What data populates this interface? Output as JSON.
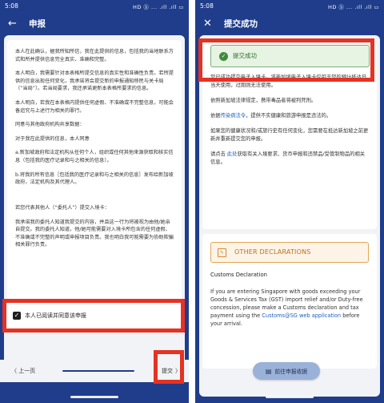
{
  "left": {
    "status": {
      "time": "5:08",
      "icons": "HD ⓑ ... .ıll .ıll ▭"
    },
    "appbar": {
      "back_icon": "←",
      "title": "申报"
    },
    "declaration": [
      "本人在此确认，据我所知所信，我在此提供的信息，包括我的当地联系方式和所并提供信息完全真实、准确和完整。",
      "本人明白，我需要针对本表格所提交信息的真实性和准确性负责。若所提供的信息出现任何变化，我承诺将会提交新的申报通知移民与关卡局（“当局”）。若当局要求，我还承诺更新本表格所要求的信息。",
      "本人明白，若我在本表格内提供任何虚假、不准确或不完整信息，可能会备追究与上述行为相关的罪行。",
      "同意与其他政府机构共享数据：",
      "对于我在此提供的信息，本人同意",
      "a.新加坡政府和法定机构从任何个人，组织或任何其他来源获取和核实信息（包括我的医疗记录和与之相关的信息）。",
      "b.将我的所有信息［包括我的医疗记录和与之相关的信息］发布给新加坡政府，法定机构及其代理人。",
      "若您代表其他人（“委托人”）提交入境卡：",
      "我承诺我的委托人知道我提交的内容，并且这一行为将被视为由他/她亲自提交。我的委托人知道，他/她可能需要对入境卡所包含的任何虚假、不准确或不完整的声明或申报项目负责。我也明白我可能需要为协助欺骗相关罪行负责。"
    ],
    "agree": {
      "check_icon": "✓",
      "label": "本人已阅读并同意该申报"
    },
    "nav": {
      "prev_label": "〈 上一页",
      "submit_label": "提交",
      "submit_icon": "〉"
    }
  },
  "right": {
    "status": {
      "time": "5:08",
      "icons": "HD ⓑ ... .ıll .ıll ▭"
    },
    "appbar": {
      "close_icon": "✕",
      "title": "提交成功"
    },
    "success_banner": {
      "icon": "✓",
      "text": "提交成功"
    },
    "paragraphs": {
      "p1": "您已成功提交电子入境卡。该新加坡电子入境卡仅可于您的预计抵达日当天使用，过期则无法使用。",
      "p2": "依照新加坡法律规定，携带毒品者将被判死刑。",
      "p3_before": "依据",
      "p3_link": "传染病法令",
      "p3_after": "，提供不实健康和旅游申报是违法的。",
      "p4": "如果您的健康状况和/或旅行史有任何变化，您需要在抵达新加坡之前更新并重新提交您的申报。",
      "p5_before": "请点击 ",
      "p5_link": "此处",
      "p5_after": "获取有关入境要求、货币申报和违禁品/受管制物品的相关信息。"
    },
    "other_declarations": {
      "icon": "✎",
      "title": "OTHER DECLARATIONS",
      "subtitle": "Customs Declaration",
      "body_before": "If you are entering Singapore with goods exceeding your Goods & Services Tax (GST) import relief and/or Duty-free concession, please make a Customs declaration and tax payment using the ",
      "body_link": "Customs@SG web application",
      "body_after": " before your arrival."
    },
    "fab": {
      "icon": "▤",
      "label": "前往申报收据"
    }
  }
}
